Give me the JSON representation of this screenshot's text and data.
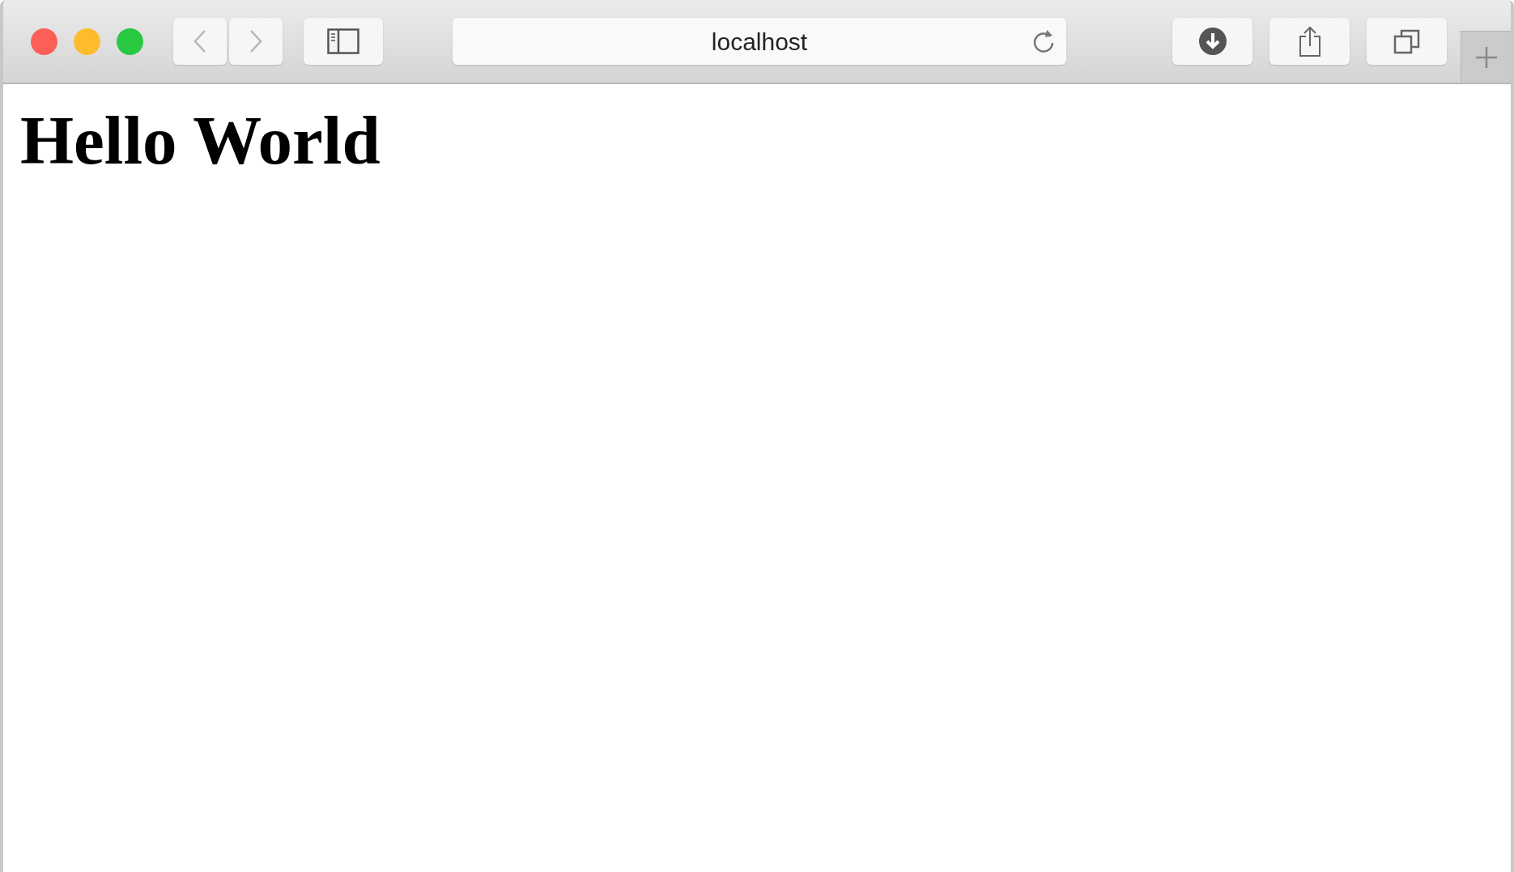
{
  "address_bar": {
    "value": "localhost"
  },
  "page": {
    "heading": "Hello World"
  }
}
